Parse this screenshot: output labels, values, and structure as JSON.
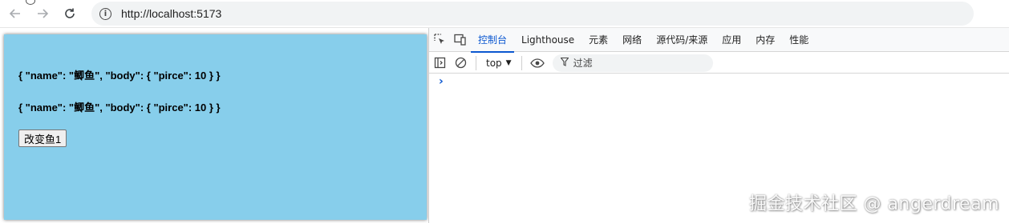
{
  "browser": {
    "url": "http://localhost:5173",
    "icons": {
      "back": "arrow-left-icon",
      "forward": "arrow-right-icon",
      "reload": "reload-icon",
      "site_info": "info-icon"
    }
  },
  "page": {
    "background_color": "#87ceeb",
    "fish_lines": [
      "{ \"name\": \"鲫鱼\", \"body\": { \"pirce\": 10 } }",
      "{ \"name\": \"鲫鱼\", \"body\": { \"pirce\": 10 } }"
    ],
    "change_button_label": "改变鱼1"
  },
  "devtools": {
    "tabs": [
      "控制台",
      "Lighthouse",
      "元素",
      "网络",
      "源代码/来源",
      "应用",
      "内存",
      "性能"
    ],
    "active_tab": "控制台",
    "context": "top",
    "filter_placeholder": "过滤",
    "prompt": "›",
    "accent_color": "#0b57d0",
    "icons": [
      "inspect-element-icon",
      "device-toolbar-icon",
      "sidebar-toggle-icon",
      "clear-console-icon",
      "eye-icon",
      "filter-icon"
    ]
  },
  "watermark": "掘金技术社区 @ angerdream"
}
